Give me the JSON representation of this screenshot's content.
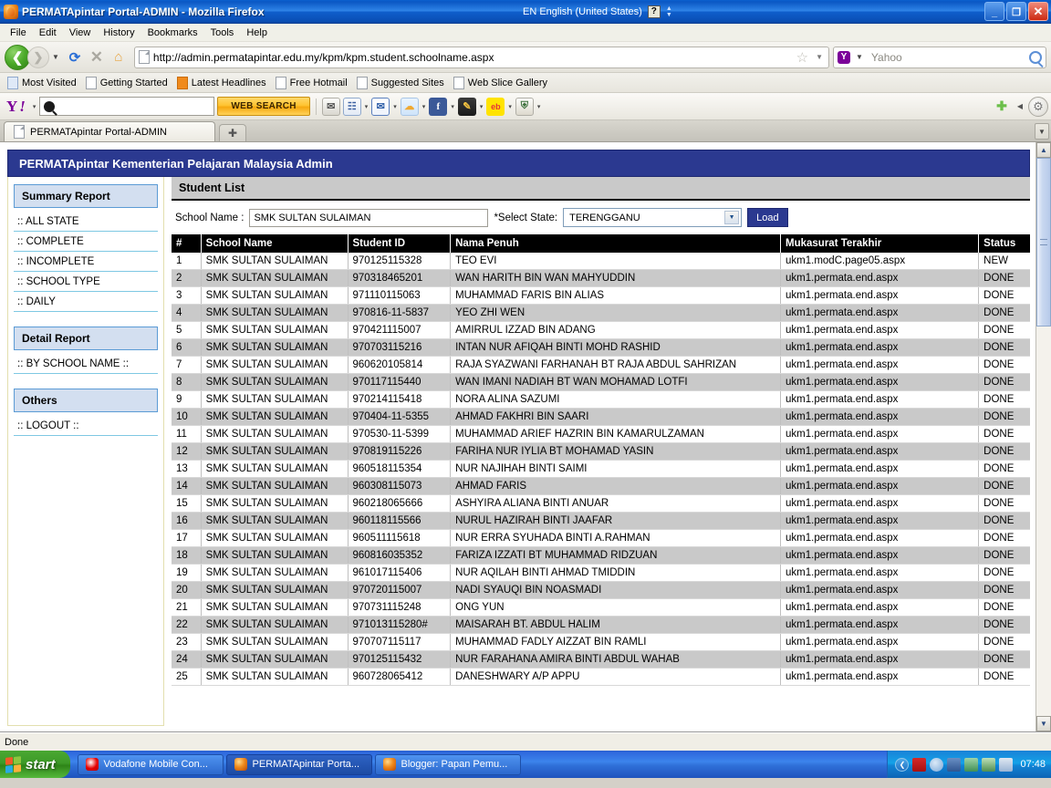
{
  "window": {
    "title": "PERMATApintar Portal-ADMIN - Mozilla Firefox",
    "app_icon": "firefox-icon",
    "language_indicator": "EN English (United States)",
    "help_glyph": "?",
    "minimize_label": "_",
    "maximize_label": "❐",
    "close_label": "✕"
  },
  "menubar": {
    "items": [
      "File",
      "Edit",
      "View",
      "History",
      "Bookmarks",
      "Tools",
      "Help"
    ]
  },
  "navbar": {
    "back_glyph": "❮",
    "forward_glyph": "❯",
    "dropdown_glyph": "▼",
    "reload_glyph": "⟳",
    "stop_glyph": "✕",
    "home_glyph": "⌂",
    "url": "http://admin.permatapintar.edu.my/kpm/kpm.student.schoolname.aspx",
    "star_glyph": "☆",
    "search_engine": "Yahoo",
    "search_placeholder": "Yahoo",
    "search_value": ""
  },
  "bookmarks": {
    "items": [
      {
        "label": "Most Visited",
        "icon": "star-bookmark-icon"
      },
      {
        "label": "Getting Started",
        "icon": "page-icon"
      },
      {
        "label": "Latest Headlines",
        "icon": "rss-icon"
      },
      {
        "label": "Free Hotmail",
        "icon": "page-icon"
      },
      {
        "label": "Suggested Sites",
        "icon": "page-icon"
      },
      {
        "label": "Web Slice Gallery",
        "icon": "page-icon"
      }
    ]
  },
  "yahoo_toolbar": {
    "logo": "Y",
    "logo_bang": "!",
    "caret": "▾",
    "search_value": "",
    "search_button": "WEB SEARCH",
    "icons": [
      {
        "name": "mailbox-icon",
        "glyph": "✉"
      },
      {
        "name": "bookmarks-icon",
        "glyph": "☷"
      },
      {
        "name": "mail-icon",
        "glyph": "✉"
      },
      {
        "name": "weather-icon",
        "glyph": "☁"
      },
      {
        "name": "facebook-icon",
        "glyph": "f"
      },
      {
        "name": "notepad-icon",
        "glyph": "✎"
      },
      {
        "name": "ebay-icon",
        "glyph": "eb"
      },
      {
        "name": "shield-icon",
        "glyph": "⛨"
      }
    ],
    "add_glyph": "✚",
    "collapse_glyph": "◀",
    "gear_glyph": "⚙"
  },
  "tabs": {
    "items": [
      {
        "label": "PERMATApintar Portal-ADMIN",
        "active": true
      }
    ],
    "new_tab_glyph": "✚",
    "list_glyph": "▼"
  },
  "app": {
    "header_title": "PERMATApintar Kementerian Pelajaran Malaysia Admin",
    "sidebar": {
      "groups": [
        {
          "heading": "Summary Report",
          "items": [
            ":: ALL STATE",
            ":: COMPLETE",
            ":: INCOMPLETE",
            ":: SCHOOL TYPE",
            ":: DAILY"
          ]
        },
        {
          "heading": "Detail Report",
          "items": [
            ":: BY SCHOOL NAME ::"
          ]
        },
        {
          "heading": "Others",
          "items": [
            ":: LOGOUT ::"
          ]
        }
      ]
    },
    "content": {
      "title": "Student List",
      "form": {
        "school_label": "School Name :",
        "school_value": "SMK SULTAN SULAIMAN",
        "state_label": "*Select State:",
        "state_value": "TERENGGANU",
        "state_arrow": "▼",
        "load_button": "Load"
      },
      "table": {
        "columns": [
          "#",
          "School Name",
          "Student ID",
          "Nama Penuh",
          "Mukasurat Terakhir",
          "Status"
        ],
        "rows": [
          [
            "1",
            "SMK SULTAN SULAIMAN",
            "970125115328",
            "TEO EVI",
            "ukm1.modC.page05.aspx",
            "NEW"
          ],
          [
            "2",
            "SMK SULTAN SULAIMAN",
            "970318465201",
            "WAN HARITH BIN WAN MAHYUDDIN",
            "ukm1.permata.end.aspx",
            "DONE"
          ],
          [
            "3",
            "SMK SULTAN SULAIMAN",
            "971110115063",
            "MUHAMMAD FARIS BIN ALIAS",
            "ukm1.permata.end.aspx",
            "DONE"
          ],
          [
            "4",
            "SMK SULTAN SULAIMAN",
            "970816-11-5837",
            "YEO ZHI WEN",
            "ukm1.permata.end.aspx",
            "DONE"
          ],
          [
            "5",
            "SMK SULTAN SULAIMAN",
            "970421115007",
            "AMIRRUL IZZAD BIN ADANG",
            "ukm1.permata.end.aspx",
            "DONE"
          ],
          [
            "6",
            "SMK SULTAN SULAIMAN",
            "970703115216",
            "INTAN NUR AFIQAH BINTI MOHD RASHID",
            "ukm1.permata.end.aspx",
            "DONE"
          ],
          [
            "7",
            "SMK SULTAN SULAIMAN",
            "960620105814",
            "RAJA SYAZWANI FARHANAH BT RAJA ABDUL SAHRIZAN",
            "ukm1.permata.end.aspx",
            "DONE"
          ],
          [
            "8",
            "SMK SULTAN SULAIMAN",
            "970117115440",
            "WAN IMANI NADIAH BT WAN MOHAMAD LOTFI",
            "ukm1.permata.end.aspx",
            "DONE"
          ],
          [
            "9",
            "SMK SULTAN SULAIMAN",
            "970214115418",
            "NORA ALINA SAZUMI",
            "ukm1.permata.end.aspx",
            "DONE"
          ],
          [
            "10",
            "SMK SULTAN SULAIMAN",
            "970404-11-5355",
            "AHMAD FAKHRI BIN SAARI",
            "ukm1.permata.end.aspx",
            "DONE"
          ],
          [
            "11",
            "SMK SULTAN SULAIMAN",
            "970530-11-5399",
            "MUHAMMAD ARIEF HAZRIN BIN KAMARULZAMAN",
            "ukm1.permata.end.aspx",
            "DONE"
          ],
          [
            "12",
            "SMK SULTAN SULAIMAN",
            "970819115226",
            "FARIHA NUR IYLIA BT MOHAMAD YASIN",
            "ukm1.permata.end.aspx",
            "DONE"
          ],
          [
            "13",
            "SMK SULTAN SULAIMAN",
            "960518115354",
            "NUR NAJIHAH BINTI SAIMI",
            "ukm1.permata.end.aspx",
            "DONE"
          ],
          [
            "14",
            "SMK SULTAN SULAIMAN",
            "960308115073",
            "AHMAD FARIS",
            "ukm1.permata.end.aspx",
            "DONE"
          ],
          [
            "15",
            "SMK SULTAN SULAIMAN",
            "960218065666",
            "ASHYIRA ALIANA BINTI ANUAR",
            "ukm1.permata.end.aspx",
            "DONE"
          ],
          [
            "16",
            "SMK SULTAN SULAIMAN",
            "960118115566",
            "NURUL HAZIRAH BINTI JAAFAR",
            "ukm1.permata.end.aspx",
            "DONE"
          ],
          [
            "17",
            "SMK SULTAN SULAIMAN",
            "960511115618",
            "NUR ERRA SYUHADA BINTI A.RAHMAN",
            "ukm1.permata.end.aspx",
            "DONE"
          ],
          [
            "18",
            "SMK SULTAN SULAIMAN",
            "960816035352",
            "FARIZA IZZATI BT MUHAMMAD RIDZUAN",
            "ukm1.permata.end.aspx",
            "DONE"
          ],
          [
            "19",
            "SMK SULTAN SULAIMAN",
            "961017115406",
            "NUR AQILAH BINTI AHMAD TMIDDIN",
            "ukm1.permata.end.aspx",
            "DONE"
          ],
          [
            "20",
            "SMK SULTAN SULAIMAN",
            "970720115007",
            "NADI SYAUQI BIN NOASMADI",
            "ukm1.permata.end.aspx",
            "DONE"
          ],
          [
            "21",
            "SMK SULTAN SULAIMAN",
            "970731115248",
            "ONG YUN",
            "ukm1.permata.end.aspx",
            "DONE"
          ],
          [
            "22",
            "SMK SULTAN SULAIMAN",
            "971013115280#",
            "MAISARAH BT. ABDUL HALIM",
            "ukm1.permata.end.aspx",
            "DONE"
          ],
          [
            "23",
            "SMK SULTAN SULAIMAN",
            "970707115117",
            "MUHAMMAD FADLY AIZZAT BIN RAMLI",
            "ukm1.permata.end.aspx",
            "DONE"
          ],
          [
            "24",
            "SMK SULTAN SULAIMAN",
            "970125115432",
            "NUR FARAHANA AMIRA BINTI ABDUL WAHAB",
            "ukm1.permata.end.aspx",
            "DONE"
          ],
          [
            "25",
            "SMK SULTAN SULAIMAN",
            "960728065412",
            "DANESHWARY A/P APPU",
            "ukm1.permata.end.aspx",
            "DONE"
          ]
        ]
      }
    }
  },
  "scrollbar": {
    "up_glyph": "▲",
    "down_glyph": "▼"
  },
  "statusbar": {
    "text": "Done"
  },
  "taskbar": {
    "start_label": "start",
    "tasks": [
      {
        "label": "Vodafone Mobile Con...",
        "icon": "vodafone-icon",
        "active": false
      },
      {
        "label": "PERMATApintar Porta...",
        "icon": "firefox-icon",
        "active": true
      },
      {
        "label": "Blogger: Papan Pemu...",
        "icon": "firefox-icon",
        "active": false
      }
    ],
    "tray_caret": "❮",
    "clock": "07:48"
  },
  "colors": {
    "titlebar_blue": "#2f84e8",
    "app_header": "#2b3990",
    "table_header": "#000000",
    "row_alt": "#c9c9c9",
    "sidebar_heading": "#d3dff0",
    "accent_border": "#5b9bd5"
  }
}
